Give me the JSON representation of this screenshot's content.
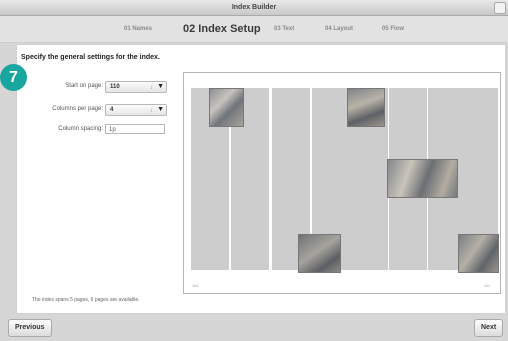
{
  "window": {
    "title": "Index Builder"
  },
  "steps": [
    {
      "label": "01 Names"
    },
    {
      "label": "02 Index Setup"
    },
    {
      "label": "03 Text"
    },
    {
      "label": "04 Layout"
    },
    {
      "label": "05 Flow"
    }
  ],
  "badge": {
    "number": "7"
  },
  "main": {
    "instruction": "Specify the general settings for the index.",
    "fields": {
      "start_label": "Start on page:",
      "start_value": "110",
      "columns_label": "Columns per page:",
      "columns_value": "4",
      "spacing_label": "Column spacing:",
      "spacing_value": "1p"
    },
    "preview": {
      "left_page_number": "110",
      "right_page_number": "111"
    },
    "footer_note": "The index spans 5 pages, 6 pages are available."
  },
  "buttons": {
    "previous": "Previous",
    "next": "Next"
  },
  "colors": {
    "badge": "#1aa6a0",
    "column": "#cdcdcd"
  }
}
